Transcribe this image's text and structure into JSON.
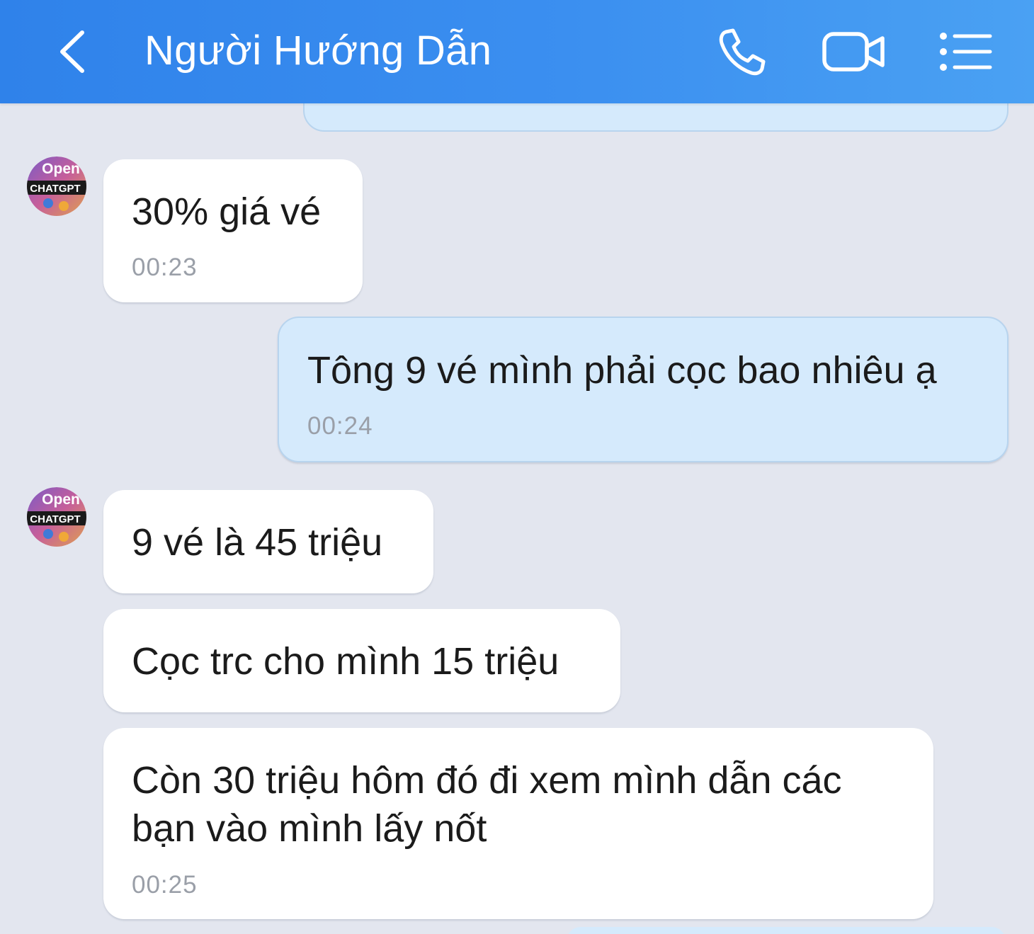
{
  "header": {
    "title": "Người Hướng Dẫn",
    "icons": {
      "back": "chevron-left-icon",
      "call": "phone-icon",
      "video": "video-camera-icon",
      "menu": "list-icon"
    },
    "colors": {
      "gradient_start": "#2f82ea",
      "gradient_end": "#4aa1f3"
    }
  },
  "avatar": {
    "line1": "Open",
    "line2": "CHATGPT"
  },
  "messages": [
    {
      "side": "incoming",
      "text": "30% giá vé",
      "time": "00:23"
    },
    {
      "side": "outgoing",
      "text": "Tông 9 vé mình phải cọc bao nhiêu ạ",
      "time": "00:24"
    },
    {
      "side": "incoming",
      "text": "9 vé là 45 triệu",
      "time": ""
    },
    {
      "side": "incoming",
      "text": "Cọc trc cho mình 15 triệu",
      "time": ""
    },
    {
      "side": "incoming",
      "text": "Còn 30 triệu hôm đó đi xem mình dẫn các\nbạn vào mình lấy nốt",
      "time": "00:25"
    }
  ],
  "colors": {
    "background": "#e3e6ef",
    "incoming_bubble": "#ffffff",
    "outgoing_bubble": "#d5eafc",
    "timestamp": "#9a9fa8"
  }
}
